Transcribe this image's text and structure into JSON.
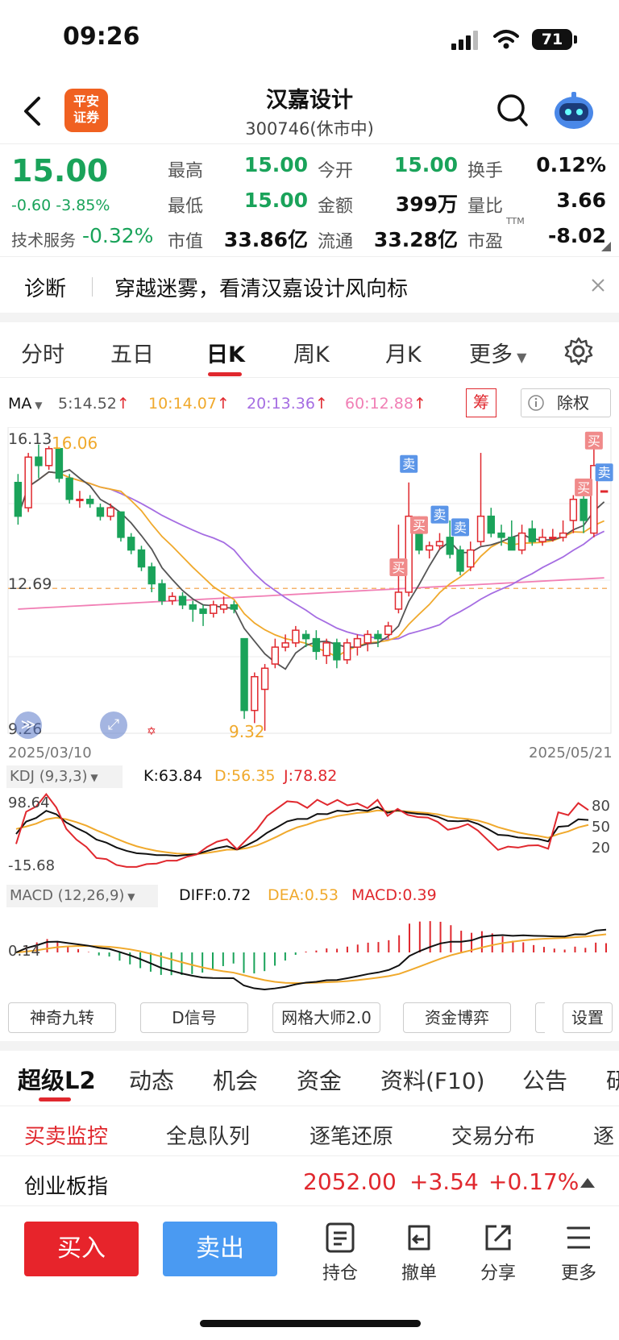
{
  "status_bar": {
    "time": "09:26",
    "battery": "71"
  },
  "header": {
    "title": "汉嘉设计",
    "subtitle": "300746(休市中)",
    "logo_text": "平安证券"
  },
  "quote": {
    "price": "15.00",
    "change": "-0.60",
    "change_pct": "-3.85%",
    "sector_label": "技术服务",
    "sector_change": "-0.32%",
    "fields": [
      {
        "label": "最高",
        "value": "15.00"
      },
      {
        "label": "今开",
        "value": "15.00"
      },
      {
        "label": "换手",
        "value": "0.12%"
      },
      {
        "label": "最低",
        "value": "15.00"
      },
      {
        "label": "金额",
        "value": "399万"
      },
      {
        "label": "量比",
        "value": "3.66"
      },
      {
        "label": "市值",
        "value": "33.86亿"
      },
      {
        "label": "流通",
        "value": "33.28亿"
      },
      {
        "label": "市盈",
        "value": "-8.02"
      }
    ],
    "ttm": "TTM"
  },
  "diag": {
    "label": "诊断",
    "text": "穿越迷雾，看清汉嘉设计风向标"
  },
  "chart_tabs": [
    "分时",
    "五日",
    "日K",
    "周K",
    "月K",
    "更多"
  ],
  "active_chart_tab": "日K",
  "ma_legend": {
    "label": "MA",
    "ma5": "5:14.52",
    "ma10": "10:14.07",
    "ma20": "20:13.36",
    "ma60": "60:12.88",
    "chip": "筹",
    "adjust": "除权"
  },
  "colors": {
    "up": "#e0282e",
    "down": "#1aa35a",
    "ma5": "#555555",
    "ma10": "#f0a92c",
    "ma20": "#a56de2",
    "ma60": "#f17fb5",
    "buy_btn": "#e7242b",
    "sell_btn": "#4a9af2"
  },
  "chart_data": {
    "type": "candlestick",
    "date_start": "2025/03/10",
    "date_end": "2025/05/21",
    "y_labels": [
      "16.13",
      "12.69",
      "9.26"
    ],
    "max_label": "16.06",
    "min_label": "9.32",
    "ylim": [
      9.26,
      16.13
    ],
    "ref_line": 12.69,
    "candles": [
      [
        15.2,
        14.4,
        15.4,
        14.2
      ],
      [
        14.6,
        15.8,
        15.9,
        14.5
      ],
      [
        15.8,
        15.6,
        16.1,
        15.3
      ],
      [
        15.6,
        16.0,
        16.06,
        15.5
      ],
      [
        16.0,
        15.3,
        16.0,
        15.2
      ],
      [
        15.3,
        14.8,
        15.4,
        14.7
      ],
      [
        14.8,
        14.8,
        15.0,
        14.6
      ],
      [
        14.8,
        14.7,
        14.9,
        14.6
      ],
      [
        14.6,
        14.4,
        14.7,
        14.3
      ],
      [
        14.4,
        14.6,
        14.7,
        14.3
      ],
      [
        14.5,
        13.9,
        14.5,
        13.8
      ],
      [
        13.9,
        13.6,
        14.0,
        13.5
      ],
      [
        13.6,
        13.2,
        13.7,
        13.1
      ],
      [
        13.2,
        12.8,
        13.3,
        12.6
      ],
      [
        12.8,
        12.4,
        12.9,
        12.3
      ],
      [
        12.4,
        12.5,
        12.6,
        12.3
      ],
      [
        12.5,
        12.3,
        12.6,
        12.2
      ],
      [
        12.3,
        12.2,
        12.4,
        11.9
      ],
      [
        12.2,
        12.1,
        12.3,
        11.8
      ],
      [
        12.1,
        12.3,
        12.4,
        12.0
      ],
      [
        12.2,
        12.3,
        12.5,
        12.1
      ],
      [
        12.3,
        12.2,
        12.4,
        12.1
      ],
      [
        11.5,
        9.8,
        11.5,
        9.6
      ],
      [
        9.8,
        10.6,
        10.7,
        9.5
      ],
      [
        10.3,
        10.8,
        10.9,
        9.32
      ],
      [
        10.9,
        11.3,
        11.5,
        10.8
      ],
      [
        11.3,
        11.4,
        11.6,
        11.2
      ],
      [
        11.4,
        11.7,
        11.8,
        11.3
      ],
      [
        11.6,
        11.5,
        11.7,
        11.3
      ],
      [
        11.5,
        11.2,
        11.7,
        11.0
      ],
      [
        11.1,
        11.4,
        11.5,
        10.9
      ],
      [
        11.4,
        11.0,
        11.5,
        10.8
      ],
      [
        11.0,
        11.4,
        11.5,
        10.9
      ],
      [
        11.3,
        11.5,
        11.6,
        11.1
      ],
      [
        11.4,
        11.6,
        11.7,
        11.2
      ],
      [
        11.6,
        11.5,
        11.7,
        11.3
      ],
      [
        11.6,
        11.8,
        11.9,
        11.5
      ],
      [
        12.2,
        12.6,
        14.2,
        12.1
      ],
      [
        12.6,
        14.4,
        15.2,
        12.5
      ],
      [
        14.1,
        13.6,
        14.4,
        13.5
      ],
      [
        13.6,
        13.7,
        13.8,
        13.4
      ],
      [
        13.7,
        13.8,
        14.0,
        13.6
      ],
      [
        13.9,
        13.5,
        14.3,
        13.4
      ],
      [
        13.6,
        13.1,
        13.7,
        13.0
      ],
      [
        13.2,
        13.6,
        13.8,
        13.1
      ],
      [
        13.8,
        14.4,
        15.9,
        13.7
      ],
      [
        14.4,
        14.0,
        14.6,
        13.9
      ],
      [
        14.0,
        13.9,
        14.2,
        13.7
      ],
      [
        13.9,
        13.6,
        14.3,
        13.6
      ],
      [
        13.6,
        14.0,
        14.2,
        13.5
      ],
      [
        14.1,
        13.8,
        14.3,
        13.7
      ],
      [
        13.8,
        13.9,
        14.1,
        13.7
      ],
      [
        13.9,
        13.9,
        14.1,
        13.8
      ],
      [
        13.9,
        14.0,
        14.3,
        13.8
      ],
      [
        14.3,
        14.8,
        14.9,
        14.0
      ],
      [
        14.8,
        14.3,
        15.0,
        14.0
      ],
      [
        14.0,
        15.6,
        16.1,
        13.9
      ],
      [
        15.0,
        15.0,
        15.0,
        15.0
      ]
    ],
    "markers": [
      {
        "index": 37,
        "label": "买"
      },
      {
        "index": 38,
        "label": "卖"
      },
      {
        "index": 39,
        "label": "买"
      },
      {
        "index": 41,
        "label": "卖"
      },
      {
        "index": 43,
        "label": "卖"
      },
      {
        "index": 55,
        "label": "买"
      },
      {
        "index": 56,
        "label": "买"
      },
      {
        "index": 57,
        "label": "卖"
      }
    ]
  },
  "kdj": {
    "label": "KDJ (9,3,3)",
    "k": "K:63.84",
    "d": "D:56.35",
    "j": "J:78.82",
    "y_top": "98.64",
    "y_bottom": "-15.68",
    "levels": [
      "80",
      "50",
      "20"
    ]
  },
  "macd": {
    "label": "MACD (12,26,9)",
    "diff": "DIFF:0.72",
    "dea": "DEA:0.53",
    "macd": "MACD:0.39",
    "y_label": "0.14"
  },
  "tools": [
    "神奇九转",
    "D信号",
    "网格大师2.0",
    "资金博弈",
    "设置"
  ],
  "sections": [
    "超级L2",
    "动态",
    "机会",
    "资金",
    "资料(F10)",
    "公告",
    "研"
  ],
  "sub_sections": [
    "买卖监控",
    "全息队列",
    "逐笔还原",
    "交易分布",
    "逐"
  ],
  "index_bar": {
    "name": "创业板指",
    "value": "2052.00",
    "change": "+3.54",
    "pct": "+0.17%"
  },
  "bottom_bar": {
    "buy": "买入",
    "sell": "卖出",
    "holdings": "持仓",
    "cancel": "撤单",
    "share": "分享",
    "more": "更多"
  }
}
